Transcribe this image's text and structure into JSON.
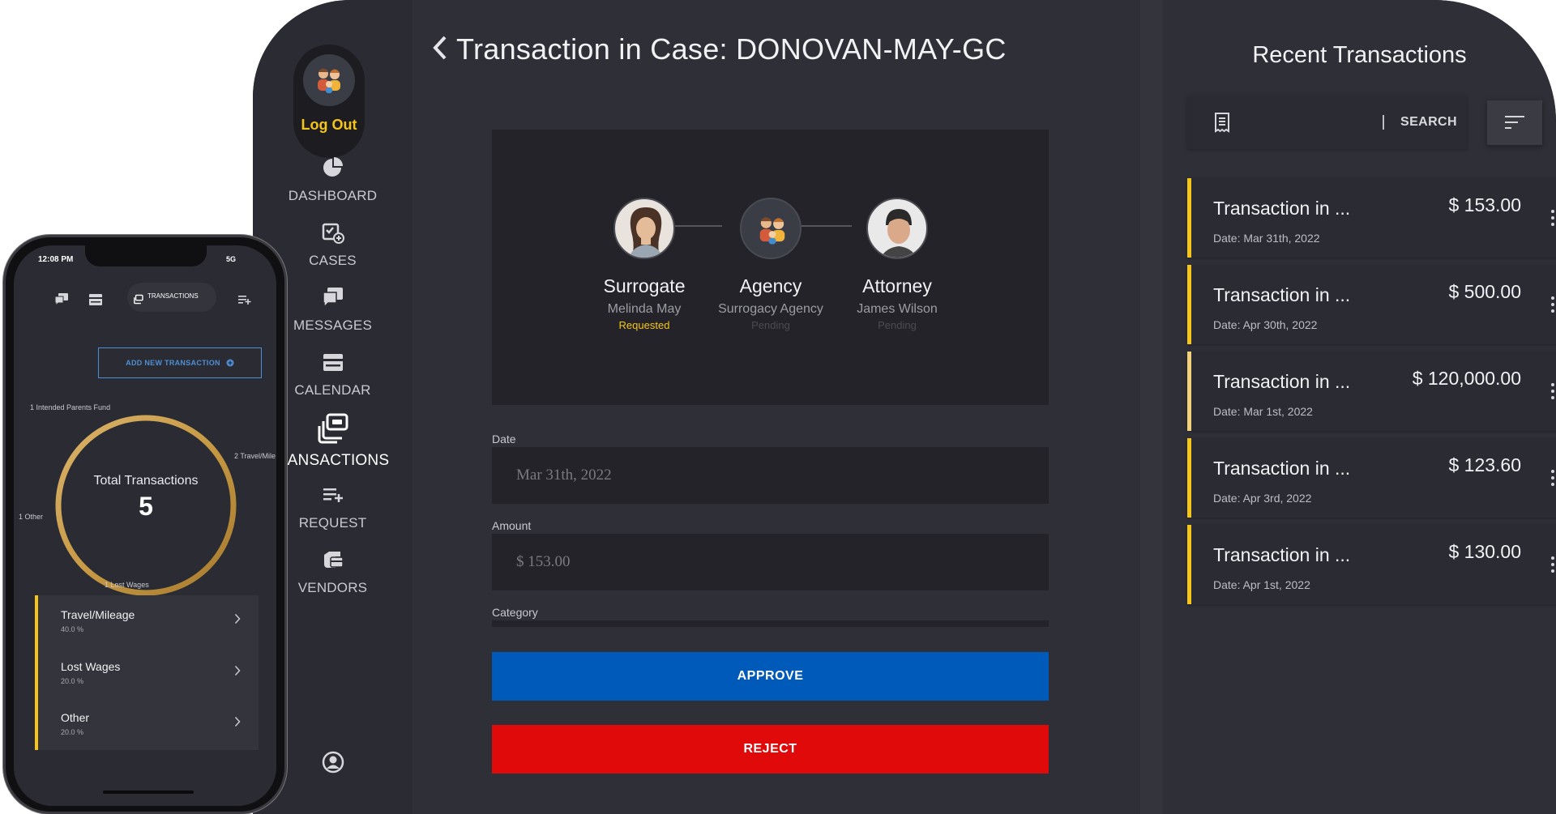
{
  "tablet": {
    "sidebar": {
      "logout_label": "Log Out",
      "items": [
        {
          "label": "DASHBOARD",
          "icon": "pie-chart-icon"
        },
        {
          "label": "CASES",
          "icon": "case-add-icon"
        },
        {
          "label": "MESSAGES",
          "icon": "messages-icon"
        },
        {
          "label": "CALENDAR",
          "icon": "calendar-icon"
        },
        {
          "label": "RANSACTIONS",
          "icon": "transactions-icon"
        },
        {
          "label": "REQUEST",
          "icon": "request-icon"
        },
        {
          "label": "VENDORS",
          "icon": "vendors-icon"
        },
        {
          "label": "",
          "icon": "profile-icon"
        }
      ]
    },
    "main": {
      "title": "Transaction in Case: DONOVAN-MAY-GC",
      "parties": [
        {
          "role": "Surrogate",
          "name": "Melinda May",
          "status": "Requested"
        },
        {
          "role": "Agency",
          "name": "Surrogacy Agency",
          "status": "Pending"
        },
        {
          "role": "Attorney",
          "name": "James Wilson",
          "status": "Pending"
        }
      ],
      "fields": {
        "date_label": "Date",
        "date_value": "Mar 31th, 2022",
        "amount_label": "Amount",
        "amount_value": "$ 153.00",
        "category_label": "Category"
      },
      "approve_label": "APPROVE",
      "reject_label": "REJECT"
    },
    "recent": {
      "title": "Recent Transactions",
      "search_label": "SEARCH",
      "transactions": [
        {
          "name": "Transaction in ...",
          "amount": "$ 153.00",
          "date": "Date: Mar 31th, 2022"
        },
        {
          "name": "Transaction in ...",
          "amount": "$ 500.00",
          "date": "Date: Apr 30th, 2022"
        },
        {
          "name": "Transaction in ...",
          "amount": "$ 120,000.00",
          "date": "Date: Mar 1st, 2022"
        },
        {
          "name": "Transaction in ...",
          "amount": "$ 123.60",
          "date": "Date: Apr 3rd, 2022"
        },
        {
          "name": "Transaction in ...",
          "amount": "$ 130.00",
          "date": "Date: Apr 1st, 2022"
        }
      ]
    }
  },
  "phone": {
    "status_time": "12:08 PM",
    "status_signal": "5G",
    "active_tab": "TRANSACTIONS",
    "add_button": "ADD NEW TRANSACTION",
    "donut": {
      "title": "Total Transactions",
      "count": "5",
      "labels": {
        "top": "1 Intended Parents Fund",
        "right": "2 Travel/Mile",
        "left": "1 Other",
        "bottom": "1 Lost Wages"
      }
    },
    "categories": [
      {
        "name": "Travel/Mileage",
        "percent": "40.0 %"
      },
      {
        "name": "Lost Wages",
        "percent": "20.0 %"
      },
      {
        "name": "Other",
        "percent": "20.0 %"
      }
    ]
  },
  "colors": {
    "accent_yellow": "#f5c518",
    "approve_blue": "#005ab9",
    "reject_red": "#e00a0a",
    "panel_dark": "#232329",
    "link_blue": "#4d8fd6"
  }
}
